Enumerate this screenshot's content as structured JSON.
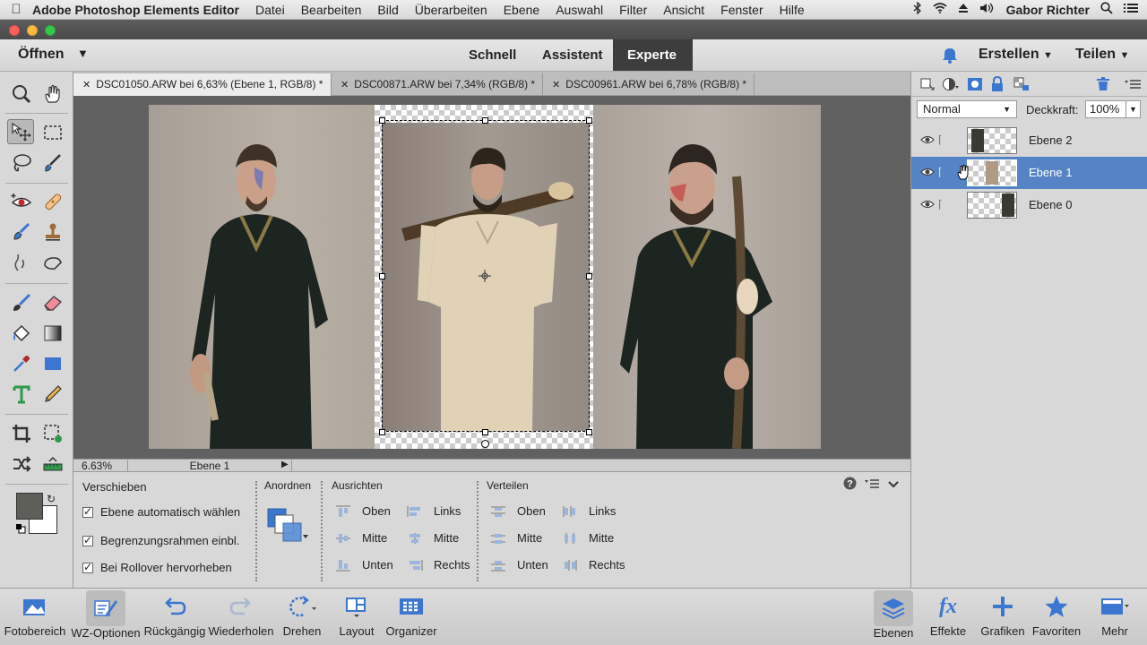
{
  "menubar": {
    "app": "Adobe Photoshop Elements Editor",
    "items": [
      "Datei",
      "Bearbeiten",
      "Bild",
      "Überarbeiten",
      "Ebene",
      "Auswahl",
      "Filter",
      "Ansicht",
      "Fenster",
      "Hilfe"
    ],
    "user": "Gabor Richter"
  },
  "appbar": {
    "open_label": "Öffnen",
    "modes": [
      "Schnell",
      "Assistent",
      "Experte"
    ],
    "active_mode": "Experte",
    "create_label": "Erstellen",
    "share_label": "Teilen"
  },
  "tabs": [
    {
      "label": "DSC01050.ARW bei 6,63% (Ebene 1, RGB/8) *",
      "active": true
    },
    {
      "label": "DSC00871.ARW bei 7,34% (RGB/8) *",
      "active": false
    },
    {
      "label": "DSC00961.ARW bei 6,78% (RGB/8) *",
      "active": false
    }
  ],
  "status": {
    "zoom": "6.63%",
    "layer": "Ebene 1"
  },
  "options": {
    "tool_name": "Verschieben",
    "checkboxes": [
      "Ebene automatisch wählen",
      "Begrenzungsrahmen einbl.",
      "Bei Rollover hervorheben"
    ],
    "arrange_label": "Anordnen",
    "align_label": "Ausrichten",
    "align_col1": [
      "Oben",
      "Mitte",
      "Unten"
    ],
    "align_col2": [
      "Links",
      "Mitte",
      "Rechts"
    ],
    "distribute_label": "Verteilen",
    "dist_col1": [
      "Oben",
      "Mitte",
      "Unten"
    ],
    "dist_col2": [
      "Links",
      "Mitte",
      "Rechts"
    ]
  },
  "panel": {
    "blend_mode": "Normal",
    "opacity_label": "Deckkraft:",
    "opacity_value": "100%",
    "layers": [
      {
        "name": "Ebene 2",
        "selected": false
      },
      {
        "name": "Ebene 1",
        "selected": true
      },
      {
        "name": "Ebene 0",
        "selected": false
      }
    ]
  },
  "bottombar": {
    "left": [
      "Fotobereich",
      "WZ-Optionen",
      "Rückgängig",
      "Wiederholen",
      "Drehen",
      "Layout",
      "Organizer"
    ],
    "right": [
      "Ebenen",
      "Effekte",
      "Grafiken",
      "Favoriten",
      "Mehr"
    ]
  },
  "colors": {
    "accent": "#5584c6",
    "foreground_color": "#5e5f59",
    "background_color": "#ffffff"
  }
}
